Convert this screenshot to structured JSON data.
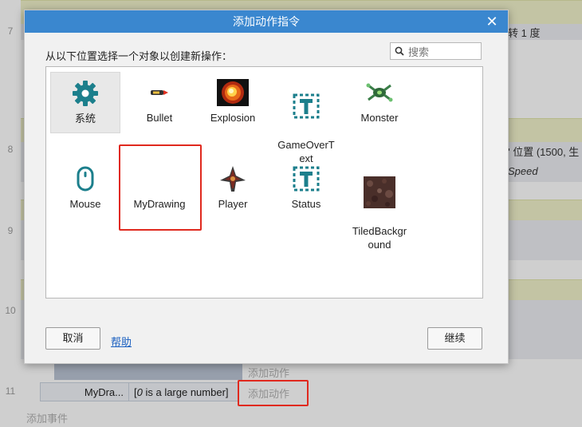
{
  "background": {
    "row_numbers": [
      "7",
      "8",
      "9",
      "10",
      "11"
    ],
    "right_texts": {
      "rotate": "转 1 度",
      "position": "\" 位置 (1500, 生",
      "speed": "Speed"
    },
    "add_action_1": "添加动作",
    "add_action_2": "添加动作",
    "add_event": "添加事件",
    "row11_object": "MyDra...",
    "row11_condition_value": "0",
    "row11_condition_rest": " is a large number]",
    "row11_condition_open": "["
  },
  "dialog": {
    "title": "添加动作指令",
    "prompt": "从以下位置选择一个对象以创建新操作：",
    "search_placeholder": "搜索",
    "objects": [
      {
        "label": "系统",
        "icon": "gear-icon"
      },
      {
        "label": "Bullet",
        "icon": "bullet-sprite-icon"
      },
      {
        "label": "Explosion",
        "icon": "explosion-sprite-icon"
      },
      {
        "label": "GameOverT\next",
        "icon": "text-object-icon"
      },
      {
        "label": "Monster",
        "icon": "monster-sprite-icon"
      },
      {
        "label": "Mouse",
        "icon": "mouse-icon"
      },
      {
        "label": "MyDrawing",
        "icon": "drawing-canvas-icon"
      },
      {
        "label": "Player",
        "icon": "player-sprite-icon"
      },
      {
        "label": "Status",
        "icon": "text-object-icon"
      },
      {
        "label": "TiledBackgr\nound",
        "icon": "tiled-background-icon"
      }
    ],
    "cancel_label": "取消",
    "help_label": "帮助",
    "continue_label": "继续"
  },
  "colors": {
    "titlebar": "#3a87cf",
    "highlight": "#e0291e",
    "accent_teal": "#1c7f8c"
  }
}
